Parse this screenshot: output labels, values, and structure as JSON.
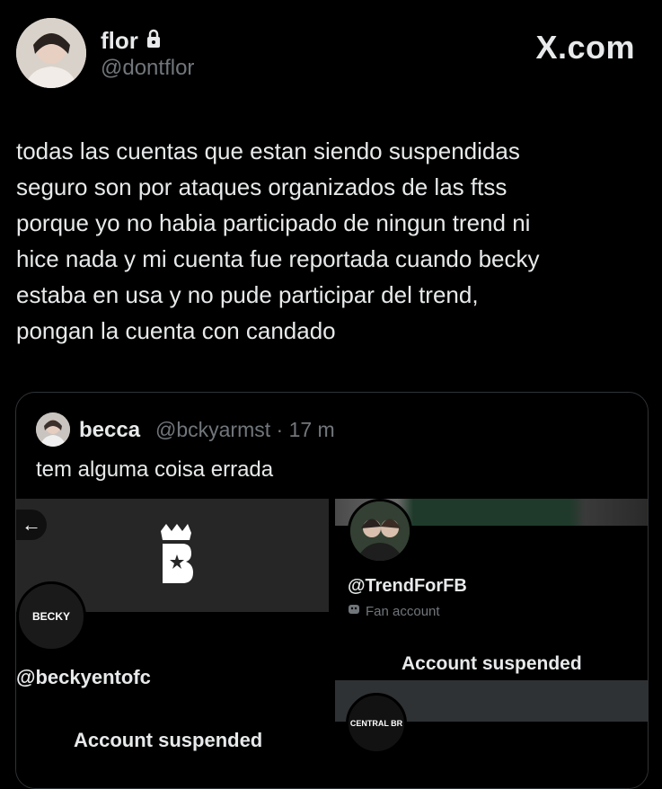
{
  "author": {
    "name": "flor",
    "handle": "@dontflor",
    "locked_icon": "lock-icon"
  },
  "brand": "X.com",
  "tweet": {
    "text": "todas las cuentas que estan siendo suspendidas\nseguro son por ataques organizados de las ftss\nporque yo no habia participado de ningun trend ni\nhice nada y mi cuenta fue reportada cuando becky\nestaba en usa y no pude participar del trend,\npongan la cuenta con candado"
  },
  "quote": {
    "name": "becca",
    "handle_time": "@bckyarmst · 17 m",
    "text": "tem alguma coisa errada",
    "left_card": {
      "back_icon": "back-arrow-icon",
      "avatar_text": "BECKY",
      "handle": "@beckyentofc",
      "status": "Account suspended"
    },
    "right_card": {
      "handle": "@TrendForFB",
      "fan_label": "Fan account",
      "status": "Account suspended",
      "avatar2_text": "CENTRAL BR"
    }
  }
}
